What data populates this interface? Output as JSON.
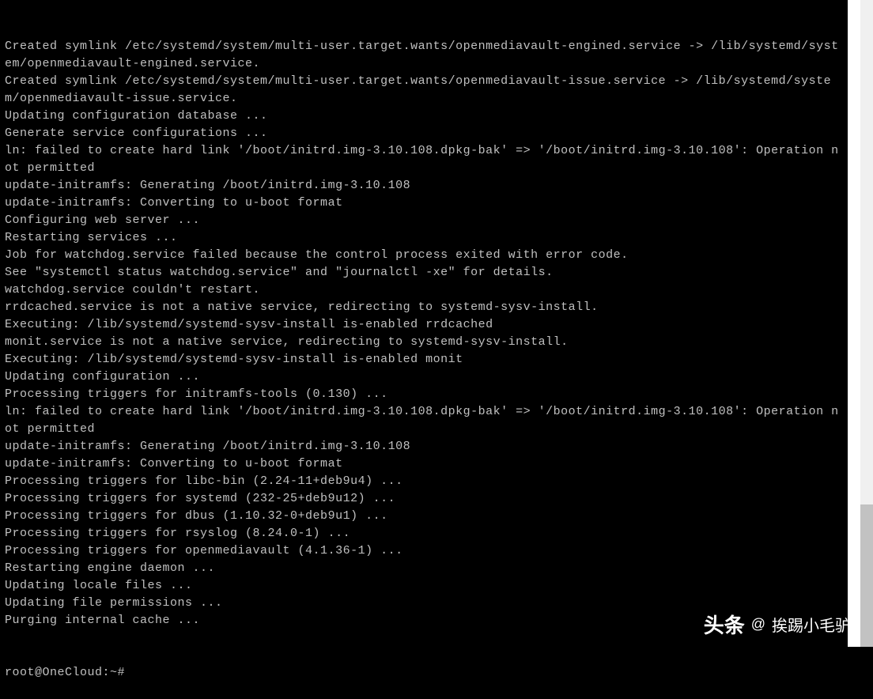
{
  "terminal": {
    "lines": [
      "Created symlink /etc/systemd/system/multi-user.target.wants/openmediavault-engined.service -> /lib/systemd/system/openmediavault-engined.service.",
      "Created symlink /etc/systemd/system/multi-user.target.wants/openmediavault-issue.service -> /lib/systemd/system/openmediavault-issue.service.",
      "Updating configuration database ...",
      "Generate service configurations ...",
      "ln: failed to create hard link '/boot/initrd.img-3.10.108.dpkg-bak' => '/boot/initrd.img-3.10.108': Operation not permitted",
      "update-initramfs: Generating /boot/initrd.img-3.10.108",
      "update-initramfs: Converting to u-boot format",
      "Configuring web server ...",
      "Restarting services ...",
      "Job for watchdog.service failed because the control process exited with error code.",
      "See \"systemctl status watchdog.service\" and \"journalctl -xe\" for details.",
      "watchdog.service couldn't restart.",
      "rrdcached.service is not a native service, redirecting to systemd-sysv-install.",
      "Executing: /lib/systemd/systemd-sysv-install is-enabled rrdcached",
      "monit.service is not a native service, redirecting to systemd-sysv-install.",
      "Executing: /lib/systemd/systemd-sysv-install is-enabled monit",
      "Updating configuration ...",
      "Processing triggers for initramfs-tools (0.130) ...",
      "ln: failed to create hard link '/boot/initrd.img-3.10.108.dpkg-bak' => '/boot/initrd.img-3.10.108': Operation not permitted",
      "update-initramfs: Generating /boot/initrd.img-3.10.108",
      "update-initramfs: Converting to u-boot format",
      "Processing triggers for libc-bin (2.24-11+deb9u4) ...",
      "Processing triggers for systemd (232-25+deb9u12) ...",
      "Processing triggers for dbus (1.10.32-0+deb9u1) ...",
      "Processing triggers for rsyslog (8.24.0-1) ...",
      "Processing triggers for openmediavault (4.1.36-1) ...",
      "Restarting engine daemon ...",
      "Updating locale files ...",
      "Updating file permissions ...",
      "Purging internal cache ..."
    ],
    "prompt": "root@OneCloud:~# "
  },
  "watermark": {
    "logo_main": "头条",
    "at": "@",
    "username": "挨踢小毛驴"
  }
}
